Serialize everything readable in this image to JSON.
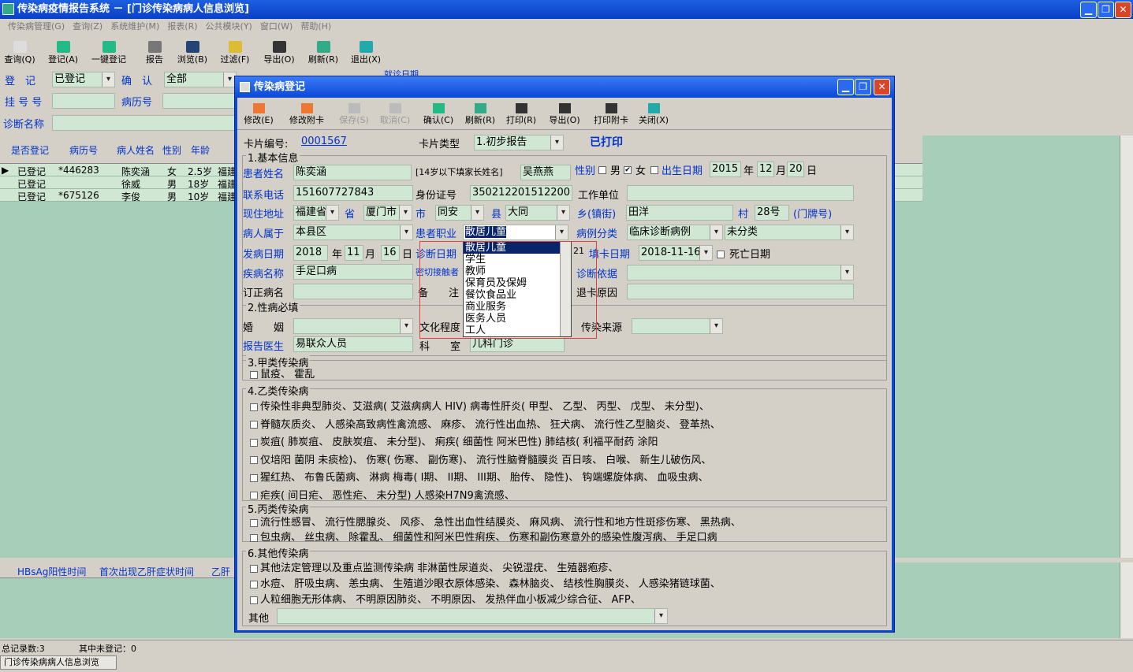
{
  "app": {
    "title": "传染病疫情报告系统  － [门诊传染病病人信息浏览]",
    "btn_min": "▁",
    "btn_max": "❐",
    "btn_close": "✕"
  },
  "menu": [
    "传染病管理(G)",
    "查询(Z)",
    "系统维护(M)",
    "报表(R)",
    "公共模块(Y)",
    "窗口(W)",
    "帮助(H)"
  ],
  "toolbar": [
    {
      "label": "查询(Q)",
      "icon": "magnifier-icon"
    },
    {
      "label": "登记(A)",
      "icon": "add-icon"
    },
    {
      "label": "一键登记",
      "icon": "add-icon"
    },
    {
      "label": "报告",
      "icon": "report-icon"
    },
    {
      "label": "浏览(B)",
      "icon": "filter-icon"
    },
    {
      "label": "过滤(F)",
      "icon": "pencil-icon"
    },
    {
      "label": "导出(O)",
      "icon": "printer-icon"
    },
    {
      "label": "刷新(R)",
      "icon": "refresh-icon"
    },
    {
      "label": "退出(X)",
      "icon": "exit-icon"
    }
  ],
  "search": {
    "reg_label": "登　记",
    "reg_value": "已登记",
    "confirm_label": "确　认",
    "confirm_value": "全部",
    "hao_label": "挂 号 号",
    "bingli_label": "病历号",
    "zhenduan_label": "诊断名称",
    "visit_date_label": "就诊日期"
  },
  "grid": {
    "headers": [
      "是否登记",
      "病历号",
      "病人姓名",
      "性别",
      "年龄"
    ],
    "rows": [
      [
        "已登记",
        "*446283",
        "陈奕涵",
        "女",
        "2.5岁",
        "福建"
      ],
      [
        "已登记",
        "",
        "徐威",
        "男",
        "18岁",
        "福建"
      ],
      [
        "已登记",
        "*675126",
        "李俊",
        "男",
        "10岁",
        "福建"
      ]
    ]
  },
  "grid2": {
    "headers": [
      "HBsAg阳性时间",
      "首次出现乙肝症状时间",
      "乙肝"
    ]
  },
  "status": {
    "total": "总记录数:3",
    "unreg": "其中未登记：0",
    "tab": "门诊传染病病人信息浏览"
  },
  "dialog": {
    "title": "传染病登记",
    "toolbar": [
      {
        "label": "修改(E)",
        "icon": "edit-icon"
      },
      {
        "label": "修改附卡",
        "icon": "edit-icon"
      },
      {
        "label": "保存(S)",
        "icon": "save-icon"
      },
      {
        "label": "取消(C)",
        "icon": "cancel-icon"
      },
      {
        "label": "确认(C)",
        "icon": "check-icon"
      },
      {
        "label": "刷新(R)",
        "icon": "refresh-icon"
      },
      {
        "label": "打印(R)",
        "icon": "printer-icon"
      },
      {
        "label": "导出(O)",
        "icon": "printer-icon"
      },
      {
        "label": "打印附卡",
        "icon": "printer-icon"
      },
      {
        "label": "关闭(X)",
        "icon": "close-icon"
      }
    ],
    "card_no_label": "卡片编号:",
    "card_no": "0001567",
    "card_type_label": "卡片类型",
    "card_type": "1.初步报告",
    "printed": "已打印",
    "s1": "1.基本信息",
    "name_label": "患者姓名",
    "name": "陈奕涵",
    "parent_label": "[14岁以下填家长姓名]",
    "parent": "吴燕燕",
    "sex_label": "性别",
    "male": "男",
    "female": "女",
    "birth_label": "出生日期",
    "birth_y": "2015",
    "year": "年",
    "birth_m": "12",
    "month": "月",
    "birth_d": "20",
    "day": "日",
    "phone_label": "联系电话",
    "phone": "151607727843",
    "id_label": "身份证号",
    "id": "350212201512200",
    "work_label": "工作单位",
    "addr_label": "现住地址",
    "prov_val": "福建省",
    "prov": "省",
    "city_val": "厦门市",
    "city": "市",
    "county_val": "同安",
    "county": "县",
    "town_val": "大同",
    "town": "乡(镇街)",
    "village_val": "田洋",
    "village": "村",
    "door_val": "28号",
    "door": "(门牌号)",
    "belong_label": "病人属于",
    "belong": "本县区",
    "job_label": "患者职业",
    "job": "散居儿童",
    "case_label": "病例分类",
    "case_val": "临床诊断病例",
    "case2": "未分类",
    "onset_label": "发病日期",
    "onset_y": "2018",
    "onset_m": "11",
    "onset_d": "16",
    "diag_date_label": "诊断日期",
    "diag_date_hour": "21",
    "fill_label": "填卡日期",
    "fill_date": "2018-11-16",
    "death_label": "死亡日期",
    "disease_label": "疾病名称",
    "disease": "手足口病",
    "contact_label": "密切接触者",
    "basis_label": "诊断依据",
    "revise_label": "订正病名",
    "remark_label": "备　　注",
    "return_label": "退卡原因",
    "s2": "2.性病必填",
    "marry_label": "婚　　姻",
    "edu_label": "文化程度",
    "source_label": "传染来源",
    "doctor_label": "报告医生",
    "doctor": "易联众人员",
    "dept_label": "科　　室",
    "dept": "儿科门诊",
    "s3": "3.甲类传染病",
    "s3_line": "鼠疫、 霍乱",
    "s4": "4.乙类传染病",
    "s4_lines": [
      "传染性非典型肺炎、艾滋病( 艾滋病病人  HIV) 病毒性肝炎( 甲型、 乙型、 丙型、 戊型、 未分型)、",
      "脊髓灰质炎、 人感染高致病性禽流感、 麻疹、 流行性出血热、 狂犬病、 流行性乙型脑炎、 登革热、",
      "炭疽( 肺炭疽、 皮肤炭疽、 未分型)、 痢疾( 细菌性 阿米巴性) 肺结核( 利福平耐药  涂阳",
      "仅培阳  菌阴  未痰检)、 伤寒( 伤寒、 副伤寒)、 流行性脑脊髓膜炎  百日咳、 白喉、 新生儿破伤风、",
      "猩红热、 布鲁氏菌病、 淋病  梅毒( I期、 II期、 III期、 胎传、 隐性)、 钩端螺旋体病、 血吸虫病、",
      "疟疾( 间日疟、 恶性疟、 未分型)  人感染H7N9禽流感、"
    ],
    "s5": "5.丙类传染病",
    "s5_lines": [
      "流行性感冒、 流行性腮腺炎、 风疹、 急性出血性结膜炎、 麻风病、 流行性和地方性斑疹伤寒、 黑热病、",
      "包虫病、 丝虫病、 除霍乱、 细菌性和阿米巴性痢疾、 伤寒和副伤寒意外的感染性腹泻病、 手足口病"
    ],
    "s6": "6.其他传染病",
    "s6_lines": [
      "其他法定管理以及重点监测传染病  非淋菌性尿道炎、 尖锐湿疣、 生殖器疱疹、",
      "水痘、 肝吸虫病、 恙虫病、 生殖道沙眼衣原体感染、 森林脑炎、 结核性胸膜炎、 人感染猪链球菌、",
      "人粒细胞无形体病、 不明原因肺炎、 不明原因、 发热伴血小板减少综合征、 AFP、"
    ],
    "other_label": "其他",
    "job_options": [
      "散居儿童",
      "学生",
      "教师",
      "保育员及保姆",
      "餐饮食品业",
      "商业服务",
      "医务人员",
      "工人"
    ]
  }
}
